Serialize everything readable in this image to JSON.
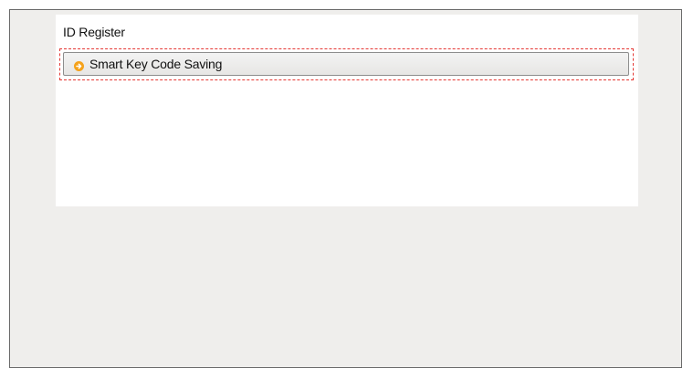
{
  "panel": {
    "title": "ID Register",
    "menu_items": [
      {
        "label": "Smart Key Code Saving",
        "icon": "arrow-right-circle-icon",
        "icon_color": "#f5a21b",
        "highlight_color": "#e53935"
      }
    ]
  }
}
